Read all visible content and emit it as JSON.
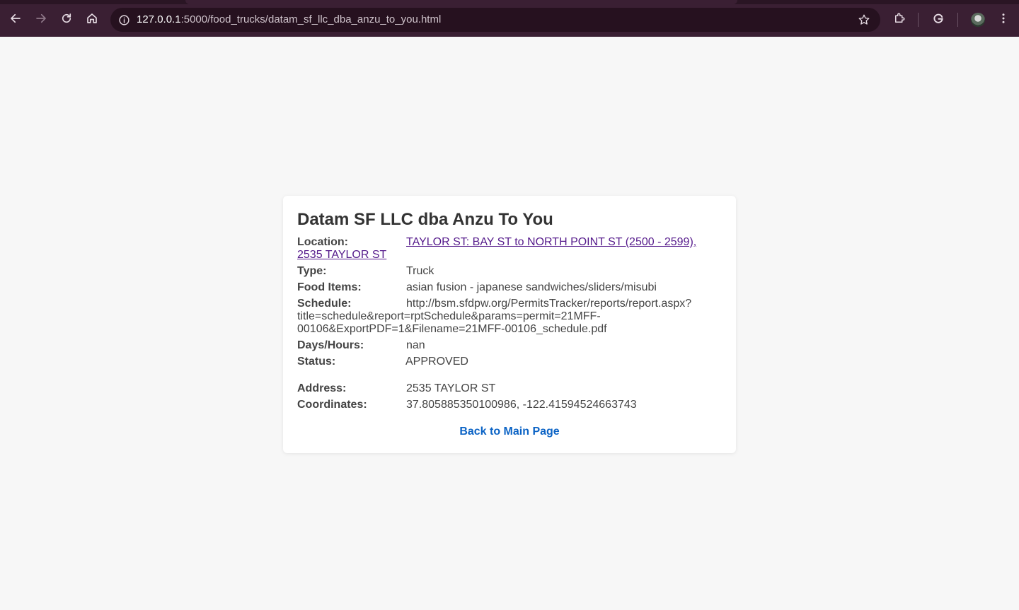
{
  "browser": {
    "url_host": "127.0.0.1",
    "url_rest": ":5000/food_trucks/datam_sf_llc_dba_anzu_to_you.html",
    "icons": [
      "back-arrow-icon",
      "forward-arrow-icon",
      "reload-icon",
      "home-icon",
      "info-icon",
      "star-icon",
      "extensions-icon",
      "google-icon",
      "avatar",
      "kebab-menu-icon"
    ]
  },
  "page": {
    "title": "Datam SF LLC dba Anzu To You",
    "location": {
      "label": "Location:",
      "value_line1": "TAYLOR ST: BAY ST to NORTH POINT ST (2500 - 2599),",
      "value_line2": "2535 TAYLOR ST"
    },
    "type": {
      "label": "Type:",
      "value": "Truck"
    },
    "food_items": {
      "label": "Food Items:",
      "value": "asian fusion - japanese sandwiches/sliders/misubi"
    },
    "schedule": {
      "label": "Schedule:",
      "value_line1": "http://bsm.sfdpw.org/PermitsTracker/reports/report.aspx?",
      "value_line2": "title=schedule&report=rptSchedule&params=permit=21MFF-",
      "value_line3": "00106&ExportPDF=1&Filename=21MFF-00106_schedule.pdf"
    },
    "days_hours": {
      "label": "Days/Hours:",
      "value": "nan"
    },
    "status": {
      "label": "Status:",
      "value": "APPROVED"
    },
    "address": {
      "label": "Address:",
      "value": "2535 TAYLOR ST"
    },
    "coordinates": {
      "label": "Coordinates:",
      "value": "37.805885350100986, -122.41594524663743"
    },
    "back_link": "Back to Main Page"
  },
  "colors": {
    "chrome_bg": "#3a1f33",
    "page_bg": "#f7f7f7",
    "visited_link": "#551a8b",
    "back_link": "#0b63c5"
  }
}
